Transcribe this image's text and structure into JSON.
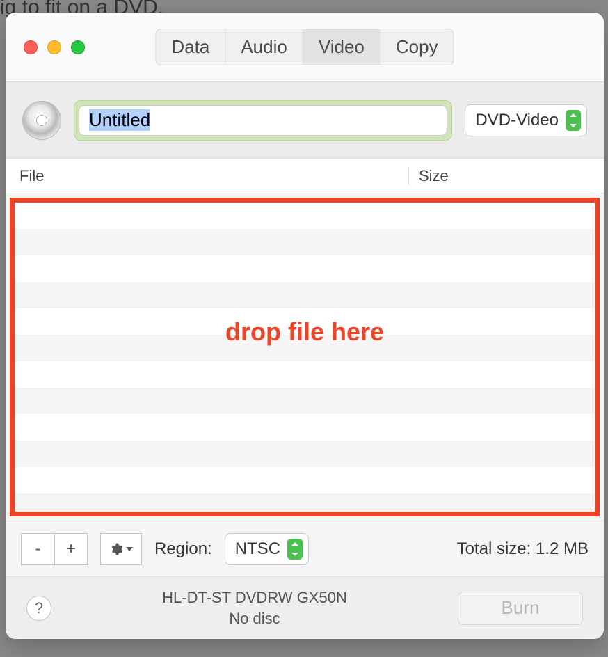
{
  "cropped_text": "ig to fit on a DVD.",
  "tabs": {
    "data": "Data",
    "audio": "Audio",
    "video": "Video",
    "copy": "Copy",
    "active": "video"
  },
  "disc_title": "Untitled",
  "format": "DVD-Video",
  "table": {
    "col_file": "File",
    "col_size": "Size"
  },
  "drop_hint": "drop file here",
  "controls": {
    "remove": "-",
    "add": "+",
    "region_label": "Region:",
    "region_value": "NTSC",
    "total_size_label": "Total size:",
    "total_size_value": "1.2 MB"
  },
  "status": {
    "drive": "HL-DT-ST DVDRW GX50N",
    "disc": "No disc",
    "help": "?",
    "burn": "Burn"
  }
}
